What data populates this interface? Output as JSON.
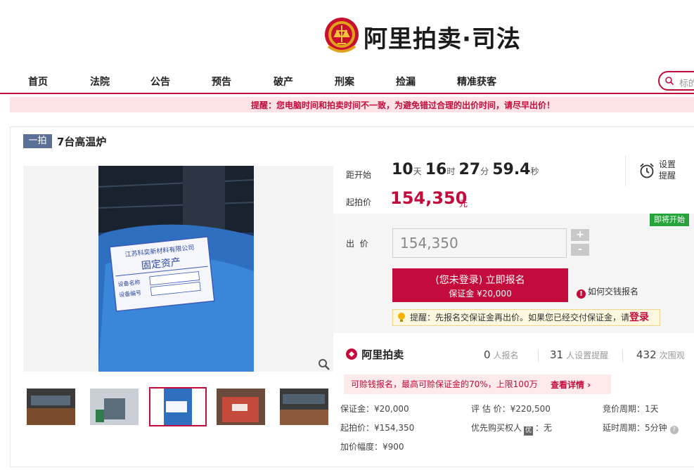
{
  "header": {
    "brand": "阿里拍卖·司法"
  },
  "nav": {
    "items": [
      "首页",
      "法院",
      "公告",
      "预告",
      "破产",
      "刑案",
      "捡漏",
      "精准获客"
    ]
  },
  "search": {
    "placeholder": "标的"
  },
  "notice": "提醒：您电脑时间和拍卖时间不一致，为避免错过合理的出价时间，请尽早出价！",
  "item": {
    "tag": "一拍",
    "title": "7台高温炉"
  },
  "gallery": {
    "plate_lines": [
      "江苏科奕新材料有限公司",
      "固定资产",
      "设备名称",
      "设备编号"
    ],
    "thumbnail_count": 5,
    "selected_index": 2
  },
  "countdown": {
    "label": "距开始",
    "days": "10",
    "days_unit": "天",
    "hours": "16",
    "hours_unit": "时",
    "minutes": "27",
    "minutes_unit": "分",
    "seconds": "59.4",
    "seconds_unit": "秒"
  },
  "start_price": {
    "label": "起拍价",
    "value": "154,350",
    "unit": "元"
  },
  "remind": {
    "line1": "设置",
    "line2": "提醒"
  },
  "badge": "即将开始",
  "bid": {
    "label": "出  价",
    "value": "154,350",
    "plus": "+",
    "minus": "-"
  },
  "register": {
    "line1": "(您未登录) 立即报名",
    "line2": "保证金 ¥20,000"
  },
  "howto": "如何交钱报名",
  "tip": {
    "text": "提醒：先报名交保证金再出价。如果您已经交付保证金，请",
    "login": "登录"
  },
  "stats": {
    "logo": "阿里拍卖",
    "signups": "0",
    "signups_label": "人报名",
    "reminders": "31",
    "reminders_label": "人设置提醒",
    "views": "432",
    "views_label": "次围观"
  },
  "loan": {
    "text": "可赊钱报名，最高可赊保证金的70%，上限100万",
    "more": "查看详情"
  },
  "details": {
    "deposit": "保证金：¥20,000",
    "appraisal": "评 估 价：¥220,500",
    "cycle": "竞价周期：1天",
    "start": "起拍价：¥154,350",
    "priority_label": "优先购买权人",
    "priority_badge": "优",
    "priority_value": "：无",
    "delay": "延时周期：5分钟",
    "increment": "加价幅度：¥900"
  },
  "colors": {
    "accent": "#c40c3c",
    "green": "#27a33d",
    "tag": "#5b7096"
  }
}
